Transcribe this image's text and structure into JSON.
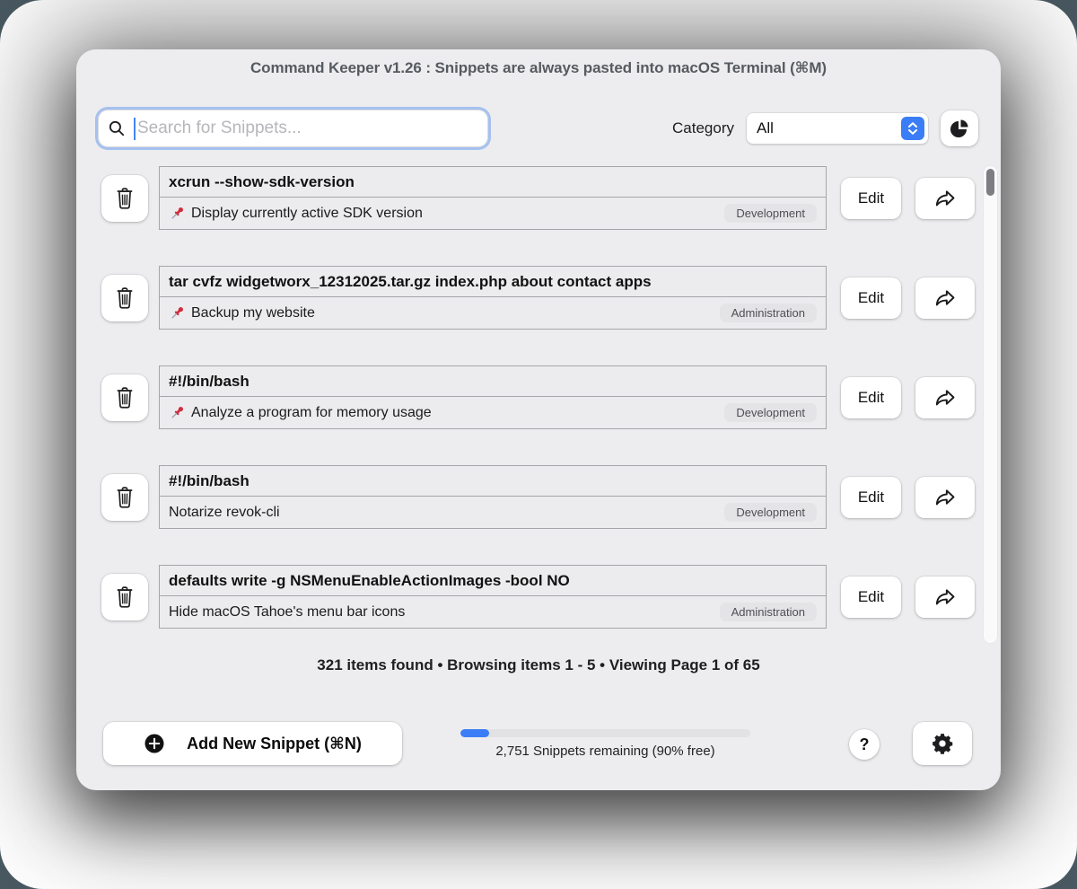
{
  "window": {
    "title": "Command Keeper v1.26 : Snippets are always pasted into macOS Terminal (⌘M)"
  },
  "toolbar": {
    "search_placeholder": "Search for Snippets...",
    "category_label": "Category",
    "category_value": "All"
  },
  "snippets": [
    {
      "command": "xcrun --show-sdk-version",
      "description": "Display currently active SDK version",
      "category": "Development",
      "pinned": true
    },
    {
      "command": "tar cvfz widgetworx_12312025.tar.gz index.php about contact apps",
      "description": "Backup my website",
      "category": "Administration",
      "pinned": true
    },
    {
      "command": "#!/bin/bash",
      "description": "Analyze a program for memory usage",
      "category": "Development",
      "pinned": true
    },
    {
      "command": "#!/bin/bash",
      "description": "Notarize revok-cli",
      "category": "Development",
      "pinned": false
    },
    {
      "command": "defaults write -g NSMenuEnableActionImages -bool NO",
      "description": "Hide macOS Tahoe's menu bar icons",
      "category": "Administration",
      "pinned": false
    }
  ],
  "actions": {
    "edit_label": "Edit"
  },
  "status_line": "321 items found • Browsing items 1 - 5 • Viewing Page 1 of 65",
  "footer": {
    "add_button_label": "Add New Snippet (⌘N)",
    "progress_percent": 10,
    "progress_caption": "2,751 Snippets remaining (90% free)",
    "help_label": "?"
  },
  "colors": {
    "accent_blue": "#3b7df7",
    "pin_red": "#d22d3d",
    "backdrop": "#4a5a62",
    "badge_bg": "#e4e4e7"
  }
}
